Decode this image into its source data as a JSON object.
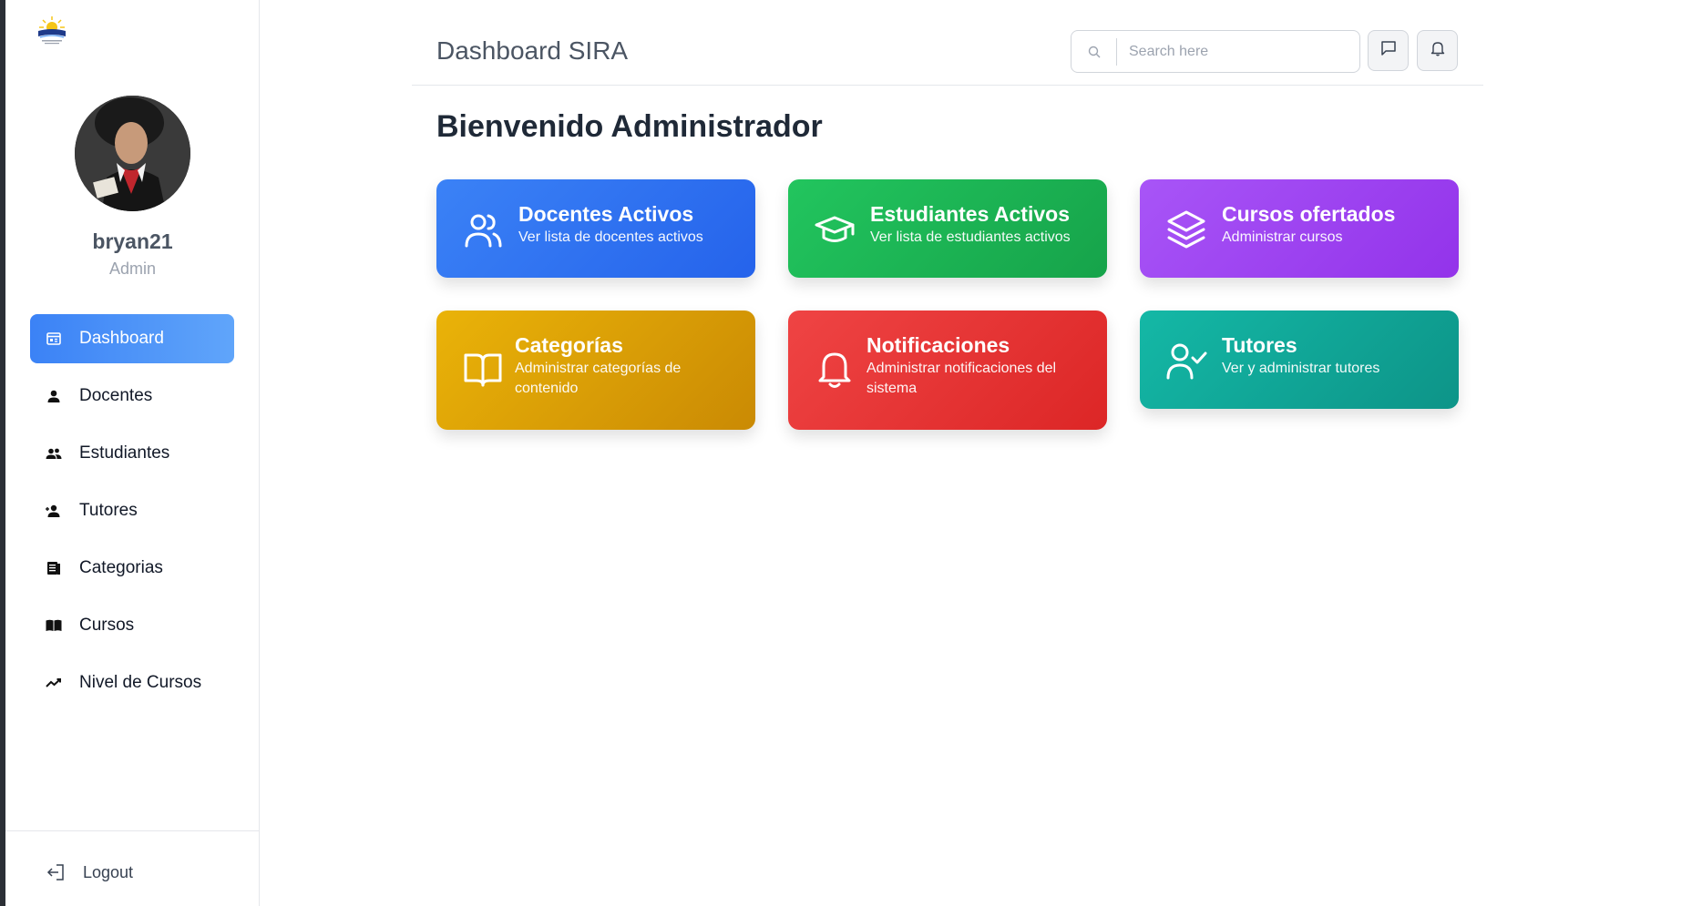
{
  "sidebar": {
    "username": "bryan21",
    "role": "Admin",
    "items": [
      {
        "label": "Dashboard",
        "icon": "dashboard-icon",
        "active": true
      },
      {
        "label": "Docentes",
        "icon": "person-icon"
      },
      {
        "label": "Estudiantes",
        "icon": "group-icon"
      },
      {
        "label": "Tutores",
        "icon": "person-add-icon"
      },
      {
        "label": "Categorias",
        "icon": "article-icon"
      },
      {
        "label": "Cursos",
        "icon": "book-icon"
      },
      {
        "label": "Nivel de Cursos",
        "icon": "trending-icon"
      }
    ],
    "logout_label": "Logout"
  },
  "header": {
    "title": "Dashboard SIRA",
    "search_placeholder": "Search here"
  },
  "main": {
    "welcome": "Bienvenido Administrador",
    "cards": [
      {
        "title": "Docentes Activos",
        "subtitle": "Ver lista de docentes activos",
        "icon": "users-icon",
        "color": "#3b82f6"
      },
      {
        "title": "Estudiantes Activos",
        "subtitle": "Ver lista de estudiantes activos",
        "icon": "graduation-cap-icon",
        "color": "#22c55e"
      },
      {
        "title": "Cursos ofertados",
        "subtitle": "Administrar cursos",
        "icon": "layers-icon",
        "color": "#a855f7"
      },
      {
        "title": "Categorías",
        "subtitle": "Administrar categorías de contenido",
        "icon": "open-book-icon",
        "color": "#eab308"
      },
      {
        "title": "Notificaciones",
        "subtitle": "Administrar notificaciones del sistema",
        "icon": "bell-icon",
        "color": "#ef4444"
      },
      {
        "title": "Tutores",
        "subtitle": "Ver y administrar tutores",
        "icon": "user-check-icon",
        "color": "#14b8a6"
      }
    ]
  }
}
